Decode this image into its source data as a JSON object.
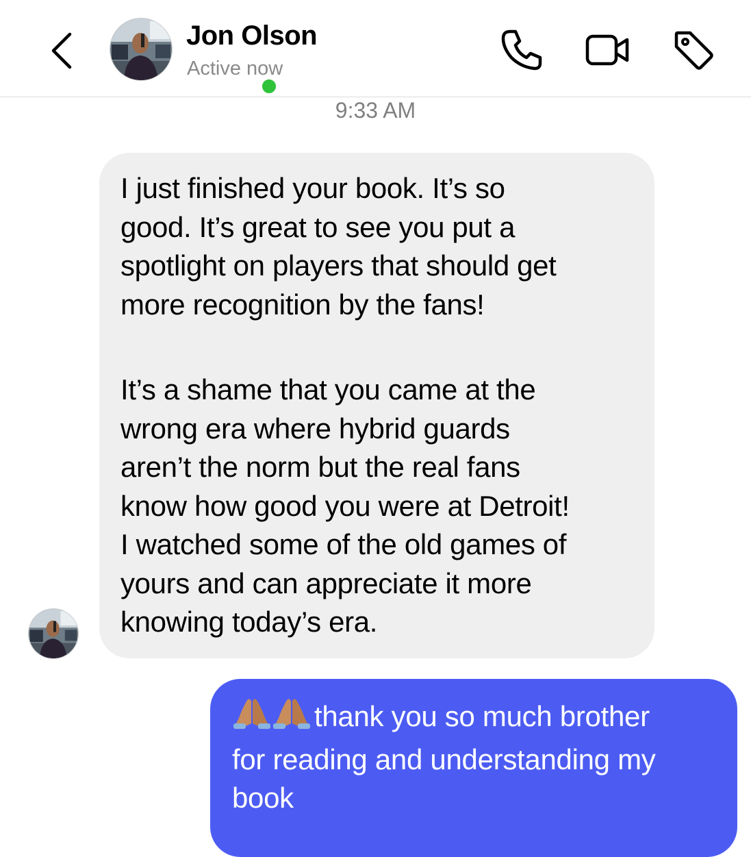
{
  "header": {
    "contact_name": "Jon Olson",
    "status": "Active now",
    "online_color": "#2ec33a",
    "icons": [
      "chevron-left-icon",
      "phone-icon",
      "video-camera-icon",
      "tag-icon"
    ]
  },
  "conversation": {
    "timestamp": "9:33 AM",
    "incoming": {
      "paragraph1_lines": [
        "I just finished your book. It’s so",
        "good. It’s great to see you put a",
        "spotlight on players that should get",
        "more recognition by the fans!"
      ],
      "paragraph2_lines": [
        "It’s a shame that you came at the",
        "wrong era where hybrid guards",
        "aren’t the norm but the real fans",
        "know how good you were at Detroit!",
        "I watched some of the old games of",
        "yours and can appreciate it more",
        "knowing today’s era."
      ],
      "bubble_color": "#efefef"
    },
    "outgoing": {
      "emoji": [
        "folded-hands-emoji",
        "folded-hands-emoji"
      ],
      "lines": [
        "thank you so much brother",
        "for reading and understanding my",
        "book"
      ],
      "bubble_color": "#4c5cf3"
    }
  }
}
